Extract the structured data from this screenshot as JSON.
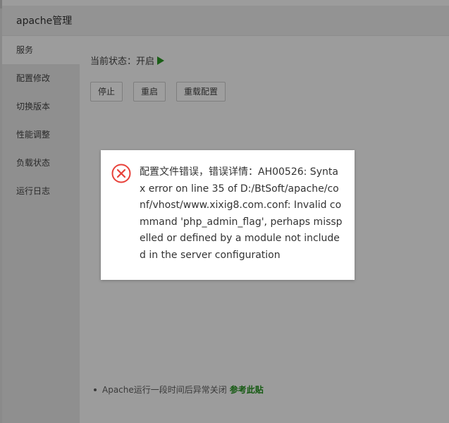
{
  "dialog": {
    "title": "apache管理"
  },
  "sidebar": {
    "items": [
      {
        "label": "服务",
        "active": true
      },
      {
        "label": "配置修改",
        "active": false
      },
      {
        "label": "切换版本",
        "active": false
      },
      {
        "label": "性能调整",
        "active": false
      },
      {
        "label": "负载状态",
        "active": false
      },
      {
        "label": "运行日志",
        "active": false
      }
    ]
  },
  "main": {
    "status_text": "当前状态：开启",
    "buttons": {
      "stop": "停止",
      "restart": "重启",
      "reload": "重载配置"
    },
    "note": {
      "text": "Apache运行一段时间后异常关闭",
      "link": "参考此贴"
    }
  },
  "error": {
    "message": "配置文件错误，错误详情：AH00526: Syntax error on line 35 of D:/BtSoft/apache/conf/vhost/www.xixig8.com.conf: Invalid command 'php_admin_flag', perhaps misspelled or defined by a module not included in the server configuration",
    "icon": "error-circle-x-icon"
  },
  "colors": {
    "error_red": "#e8413a",
    "running_green": "#20a53a"
  }
}
